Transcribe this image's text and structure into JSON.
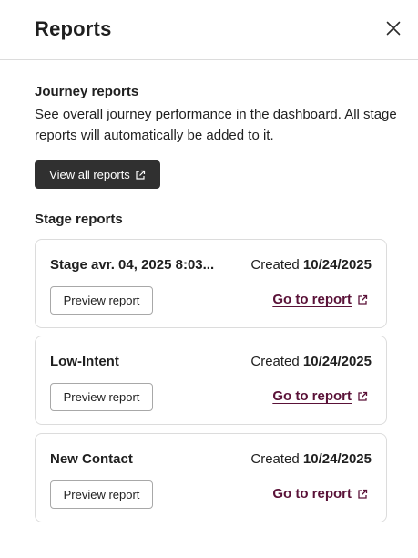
{
  "header": {
    "title": "Reports",
    "close_icon": "close-icon"
  },
  "journey": {
    "heading": "Journey reports",
    "description": "See overall journey performance in the dashboard. All stage reports will automatically be added to it.",
    "view_all_label": "View all reports",
    "view_all_icon": "external-link-icon"
  },
  "stage": {
    "heading": "Stage reports",
    "cards": [
      {
        "name": "Stage avr. 04, 2025 8:03...",
        "created_label": "Created",
        "created_date": "10/24/2025",
        "preview_label": "Preview report",
        "go_label": "Go to report"
      },
      {
        "name": "Low-Intent",
        "created_label": "Created",
        "created_date": "10/24/2025",
        "preview_label": "Preview report",
        "go_label": "Go to report"
      },
      {
        "name": "New Contact",
        "created_label": "Created",
        "created_date": "10/24/2025",
        "preview_label": "Preview report",
        "go_label": "Go to report"
      }
    ]
  },
  "colors": {
    "dark_button": "#303030",
    "link": "#5a1238",
    "border": "#dcdcdc"
  }
}
